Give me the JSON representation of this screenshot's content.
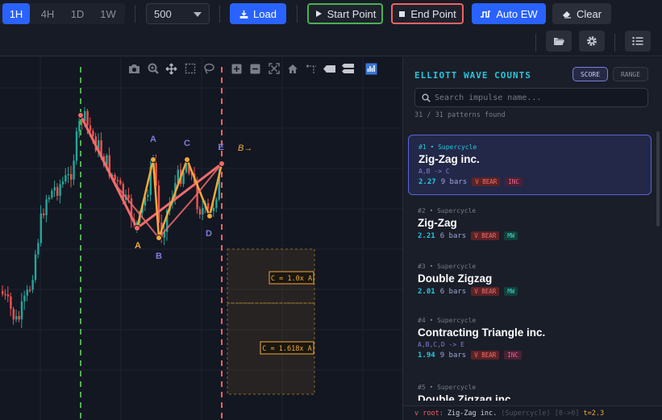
{
  "toolbar": {
    "timeframes": [
      {
        "label": "1H",
        "active": true
      },
      {
        "label": "4H",
        "active": false
      },
      {
        "label": "1D",
        "active": false
      },
      {
        "label": "1W",
        "active": false
      }
    ],
    "bars_select": "500",
    "load_label": "Load",
    "start_point_label": "Start Point",
    "end_point_label": "End Point",
    "auto_ew_label": "Auto EW",
    "clear_label": "Clear",
    "icons": [
      "folder-open-icon",
      "gear-icon",
      "list-icon"
    ]
  },
  "chart": {
    "tool_icons": [
      "camera-icon",
      "zoom-icon",
      "pan-icon",
      "box-select-icon",
      "lasso-icon",
      "zoom-in-icon",
      "zoom-out-icon",
      "autoscale-icon",
      "home-icon",
      "spike-lines-icon",
      "closest-hover-icon",
      "compare-hover-icon",
      "bar-chart-icon"
    ],
    "wave_labels": [
      {
        "text": "A",
        "color": "#7c7fd8"
      },
      {
        "text": "C",
        "color": "#7c7fd8"
      },
      {
        "text": "E",
        "color": "#7c7fd8"
      },
      {
        "text": "A",
        "color": "#f2a93b"
      },
      {
        "text": "B",
        "color": "#7c7fd8"
      },
      {
        "text": "D",
        "color": "#7c7fd8"
      }
    ],
    "projection_label": "B→",
    "fib_boxes": [
      {
        "label": "C = 1.0x A"
      },
      {
        "label": "C = 1.618x A"
      }
    ],
    "colors": {
      "up": "#26a69a",
      "down": "#ef5350",
      "pattern_line": "#f06b6b",
      "sub_line": "#f2a93b",
      "start_marker": "#4caf50",
      "end_marker": "#f06262"
    }
  },
  "panel": {
    "title": "ELLIOTT WAVE COUNTS",
    "sort_score": "SCORE",
    "sort_range": "RANGE",
    "search_placeholder": "Search impulse name...",
    "found_text": "31 / 31 patterns found",
    "patterns": [
      {
        "meta": "#1  •  Supercycle",
        "name": "Zig-Zag inc.",
        "sub": "A,B -> C",
        "score": "2.27",
        "bars": "9 bars",
        "tags": [
          {
            "text": "V BEAR",
            "kind": "bear"
          },
          {
            "text": "INC",
            "kind": "inc"
          }
        ],
        "selected": true
      },
      {
        "meta": "#2  •  Supercycle",
        "name": "Zig-Zag",
        "sub": "",
        "score": "2.21",
        "bars": "6 bars",
        "tags": [
          {
            "text": "V BEAR",
            "kind": "bear"
          },
          {
            "text": "MW",
            "kind": "mw"
          }
        ],
        "selected": false
      },
      {
        "meta": "#3  •  Supercycle",
        "name": "Double Zigzag",
        "sub": "",
        "score": "2.01",
        "bars": "6 bars",
        "tags": [
          {
            "text": "V BEAR",
            "kind": "bear"
          },
          {
            "text": "MW",
            "kind": "mw"
          }
        ],
        "selected": false
      },
      {
        "meta": "#4  •  Supercycle",
        "name": "Contracting Triangle inc.",
        "sub": "A,B,C,D -> E",
        "score": "1.94",
        "bars": "9 bars",
        "tags": [
          {
            "text": "V BEAR",
            "kind": "bear"
          },
          {
            "text": "INC",
            "kind": "inc"
          }
        ],
        "selected": false
      },
      {
        "meta": "#5  •  Supercycle",
        "name": "Double Zigzag inc.",
        "sub": "",
        "score": "",
        "bars": "",
        "tags": [],
        "selected": false
      }
    ],
    "footer": {
      "root": "v root:",
      "name": "Zig-Zag inc.",
      "detail": "(Supercycle) [0->0]",
      "t": "t=2.3"
    }
  }
}
